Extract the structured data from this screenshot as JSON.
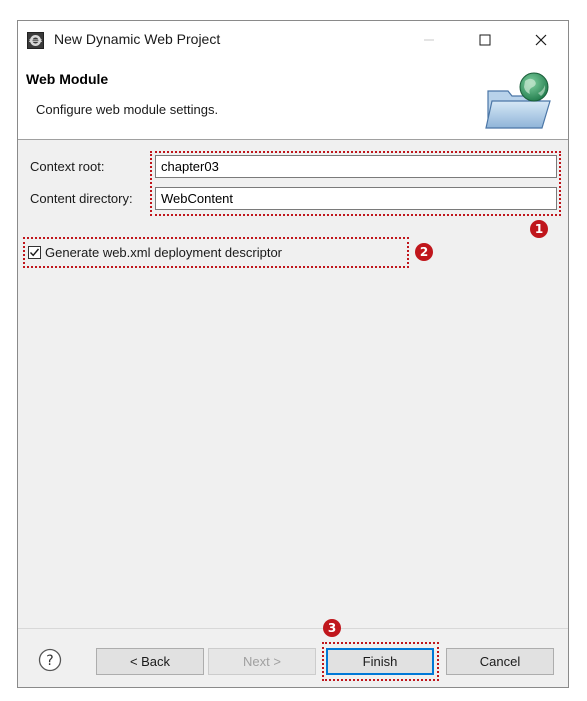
{
  "window": {
    "title": "New Dynamic Web Project"
  },
  "header": {
    "title": "Web Module",
    "description": "Configure web module settings."
  },
  "form": {
    "context_root_label": "Context root:",
    "context_root_value": "chapter03",
    "content_directory_label": "Content directory:",
    "content_directory_value": "WebContent",
    "generate_webxml_label": "Generate web.xml deployment descriptor",
    "generate_webxml_checked": true
  },
  "buttons": {
    "back": "< Back",
    "next": "Next >",
    "finish": "Finish",
    "cancel": "Cancel"
  },
  "annotations": {
    "marker1": "1",
    "marker2": "2",
    "marker3": "3",
    "highlight_color": "#c0161c"
  },
  "icons": {
    "app": "eclipse-icon",
    "header": "folder-globe-icon",
    "help": "question-icon"
  }
}
